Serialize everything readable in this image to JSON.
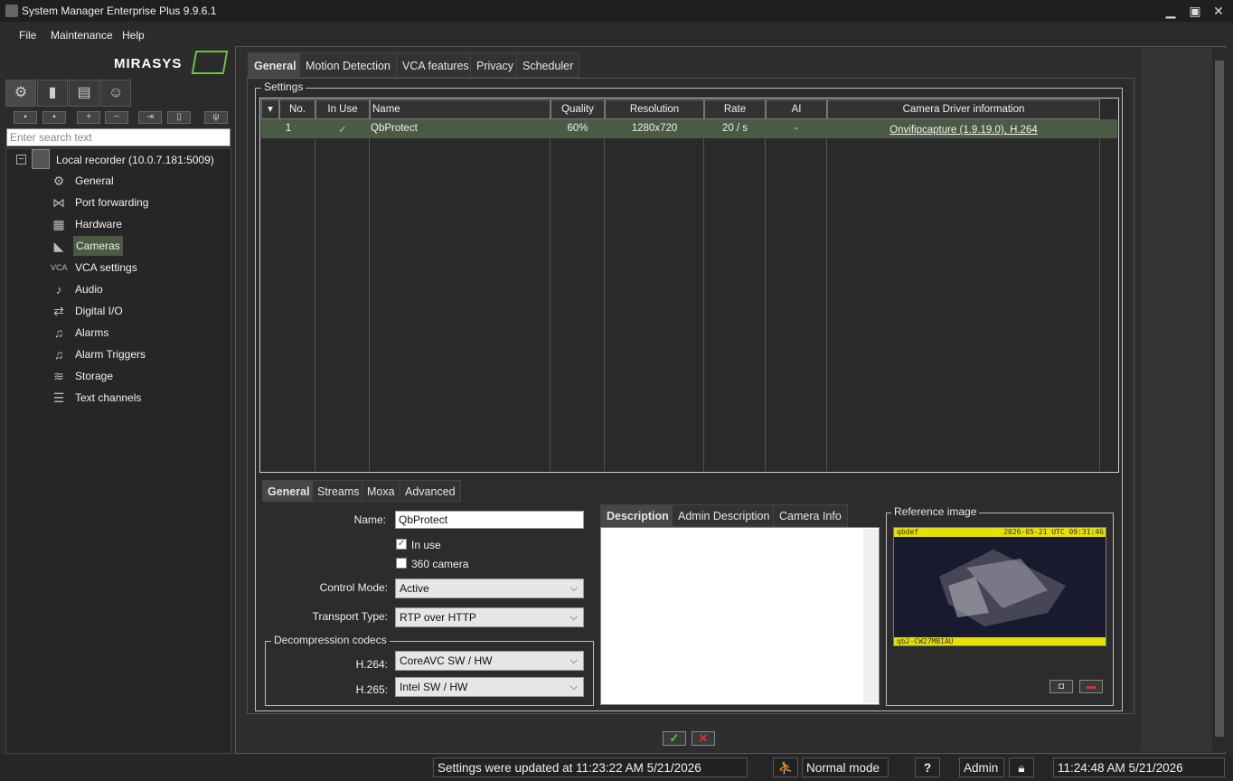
{
  "window": {
    "title": "System Manager Enterprise Plus 9.9.6.1",
    "min_glyph": "▁",
    "max_glyph": "▣",
    "close_glyph": "✕"
  },
  "menu": {
    "items": [
      "File",
      "Maintenance",
      "Help"
    ]
  },
  "logo": {
    "text": "MIRASYS",
    "accent": "#6fbf4a"
  },
  "sidebar": {
    "search_placeholder": "Enter search text",
    "root": {
      "label": "Local recorder (10.0.7.181:5009)",
      "collapse_glyph": "−"
    },
    "items": [
      {
        "label": "General",
        "icon": "gear-icon",
        "glyph": "⚙"
      },
      {
        "label": "Port forwarding",
        "icon": "share-icon",
        "glyph": "⋈"
      },
      {
        "label": "Hardware",
        "icon": "chip-icon",
        "glyph": "▦"
      },
      {
        "label": "Cameras",
        "icon": "camera-icon",
        "glyph": "◣",
        "selected": true
      },
      {
        "label": "VCA settings",
        "icon": "vca-icon",
        "glyph": "VCA"
      },
      {
        "label": "Audio",
        "icon": "microphone-icon",
        "glyph": "♪"
      },
      {
        "label": "Digital I/O",
        "icon": "io-icon",
        "glyph": "⇄"
      },
      {
        "label": "Alarms",
        "icon": "bell-icon",
        "glyph": "♫"
      },
      {
        "label": "Alarm Triggers",
        "icon": "bell-plus-icon",
        "glyph": "♫"
      },
      {
        "label": "Storage",
        "icon": "layers-icon",
        "glyph": "≋"
      },
      {
        "label": "Text channels",
        "icon": "list-icon",
        "glyph": "☰"
      }
    ]
  },
  "tabs": [
    "General",
    "Motion Detection",
    "VCA features",
    "Privacy",
    "Scheduler"
  ],
  "settings": {
    "legend": "Settings",
    "columns": [
      "No.",
      "In Use",
      "Name",
      "Quality",
      "Resolution",
      "Rate",
      "AI",
      "Camera Driver information"
    ],
    "rows": [
      {
        "no": "1",
        "in_use": "✓",
        "name": "QbProtect",
        "quality": "60%",
        "resolution": "1280x720",
        "rate": "20 / s",
        "ai": "-",
        "driver": "Onvifipcapture (1.9.19.0), H.264"
      }
    ]
  },
  "subtabs": [
    "General",
    "Streams",
    "Moxa",
    "Advanced"
  ],
  "form": {
    "name_label": "Name:",
    "name_value": "QbProtect",
    "in_use_label": "In use",
    "in_use_checked": true,
    "cam360_label": "360 camera",
    "cam360_checked": false,
    "control_mode_label": "Control Mode:",
    "control_mode_value": "Active",
    "transport_label": "Transport Type:",
    "transport_value": "RTP over HTTP",
    "codecs_legend": "Decompression codecs",
    "h264_label": "H.264:",
    "h264_value": "CoreAVC SW / HW",
    "h265_label": "H.265:",
    "h265_value": "Intel SW / HW"
  },
  "desc_tabs": [
    "Description",
    "Admin Description",
    "Camera Info"
  ],
  "reference": {
    "legend": "Reference image",
    "top_left": "qbdef",
    "top_right": "2026-05-21 UTC 09:31:46",
    "bottom": "qb2-CW27MBIAU"
  },
  "status": {
    "message": "Settings were updated at 11:23:22 AM 5/21/2026",
    "mode": "Normal mode",
    "help": "?",
    "user": "Admin",
    "clock": "11:24:48 AM 5/21/2026"
  },
  "colors": {
    "selected_row": "#4a5a44",
    "ok": "#4fd04f",
    "cancel": "#e03030"
  }
}
